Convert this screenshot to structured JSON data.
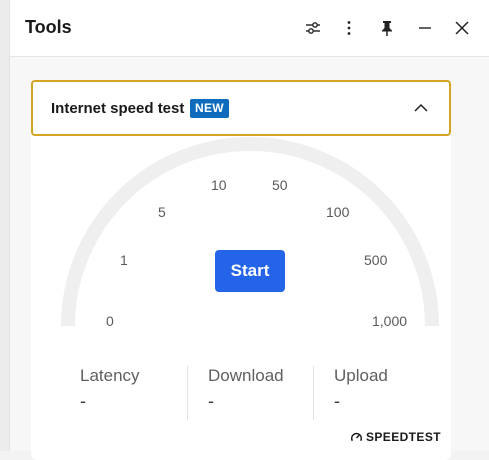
{
  "window": {
    "title": "Tools",
    "buttons": [
      {
        "icon": "settings-sliders-icon"
      },
      {
        "icon": "more-options-icon"
      },
      {
        "icon": "pin-icon"
      },
      {
        "icon": "minimize-icon"
      },
      {
        "icon": "close-icon"
      }
    ]
  },
  "card": {
    "title": "Internet speed test",
    "badge": "NEW",
    "expanded": true,
    "accent_color": "#d5a425",
    "badge_color": "#0f6cbd"
  },
  "gauge": {
    "scale_labels": [
      "0",
      "1",
      "5",
      "10",
      "50",
      "100",
      "500",
      "1,000"
    ],
    "track_color": "#efefef"
  },
  "start_button": {
    "label": "Start",
    "color": "#2364e8"
  },
  "stats": [
    {
      "label": "Latency",
      "value": "-"
    },
    {
      "label": "Download",
      "value": "-"
    },
    {
      "label": "Upload",
      "value": "-"
    }
  ],
  "branding": {
    "text": "SPEEDTEST"
  }
}
